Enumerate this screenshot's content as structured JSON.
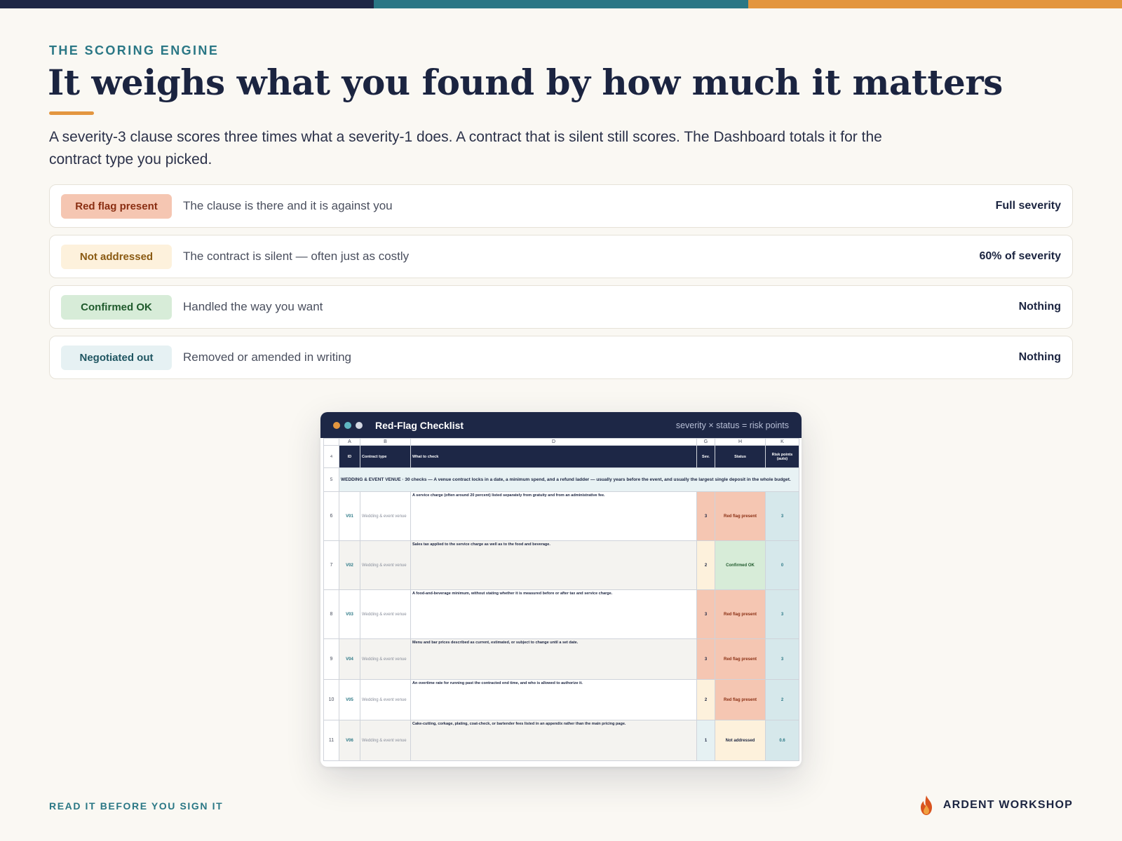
{
  "colors": {
    "topbar": [
      "#1d2746",
      "#2a7785",
      "#e3963f"
    ],
    "accent": "#e3963f",
    "teal": "#2a7785",
    "navy": "#1d2746"
  },
  "eyebrow": "THE SCORING ENGINE",
  "headline": "It weighs what you found by how much it matters",
  "lede": "A severity-3 clause scores three times what a severity-1 does. A contract that is silent still scores. The Dashboard totals it for the contract type you picked.",
  "statuses": [
    {
      "label": "Red flag present",
      "description": "The clause is there and it is against you",
      "weight": "Full severity",
      "bg": "#f5c6b2",
      "fg": "#8a2e12"
    },
    {
      "label": "Not addressed",
      "description": "The contract is silent — often just as costly",
      "weight": "60% of severity",
      "bg": "#fdf1dc",
      "fg": "#8a5a12"
    },
    {
      "label": "Confirmed OK",
      "description": "Handled the way you want",
      "weight": "Nothing",
      "bg": "#d7ecd8",
      "fg": "#1f5a2c"
    },
    {
      "label": "Negotiated out",
      "description": "Removed or amended in writing",
      "weight": "Nothing",
      "bg": "#e6f1f3",
      "fg": "#1f5561"
    }
  ],
  "sheet": {
    "title": "Red-Flag Checklist",
    "formula": "severity × status = risk points",
    "window_dots": [
      "#e3963f",
      "#5fb7c2",
      "#d4d8e2"
    ],
    "column_letters": [
      "",
      "A",
      "B",
      "D",
      "G",
      "H",
      "K"
    ],
    "header_row_number": "4",
    "headers": [
      "ID",
      "Contract type",
      "What to check",
      "Sev.",
      "Status",
      "Risk points (auto)"
    ],
    "section_row_number": "5",
    "section_text": "WEDDING & EVENT VENUE · 30 checks — A venue contract locks in a date, a minimum spend, and a refund ladder — usually years before the event, and usually the largest single deposit in the whole budget.",
    "rows": [
      {
        "n": "6",
        "id": "V01",
        "type": "Wedding & event venue",
        "check": "A service charge (often around 20 percent) listed separately from gratuity and from an administrative fee.",
        "sev": "3",
        "status": "Red flag present",
        "points": "3"
      },
      {
        "n": "7",
        "id": "V02",
        "type": "Wedding & event venue",
        "check": "Sales tax applied to the service charge as well as to the food and beverage.",
        "sev": "2",
        "status": "Confirmed OK",
        "points": "0"
      },
      {
        "n": "8",
        "id": "V03",
        "type": "Wedding & event venue",
        "check": "A food-and-beverage minimum, without stating whether it is measured before or after tax and service charge.",
        "sev": "3",
        "status": "Red flag present",
        "points": "3"
      },
      {
        "n": "9",
        "id": "V04",
        "type": "Wedding & event venue",
        "check": "Menu and bar prices described as current, estimated, or subject to change until a set date.",
        "sev": "3",
        "status": "Red flag present",
        "points": "3"
      },
      {
        "n": "10",
        "id": "V05",
        "type": "Wedding & event venue",
        "check": "An overtime rate for running past the contracted end time, and who is allowed to authorize it.",
        "sev": "2",
        "status": "Red flag present",
        "points": "2"
      },
      {
        "n": "11",
        "id": "V06",
        "type": "Wedding & event venue",
        "check": "Cake-cutting, corkage, plating, coat-check, or bartender fees listed in an appendix rather than the main pricing page.",
        "sev": "1",
        "status": "Not addressed",
        "points": "0.6"
      }
    ]
  },
  "footer": {
    "tagline": "READ IT BEFORE YOU SIGN IT",
    "brand": "ARDENT WORKSHOP",
    "brand_icon": "flame-icon"
  }
}
